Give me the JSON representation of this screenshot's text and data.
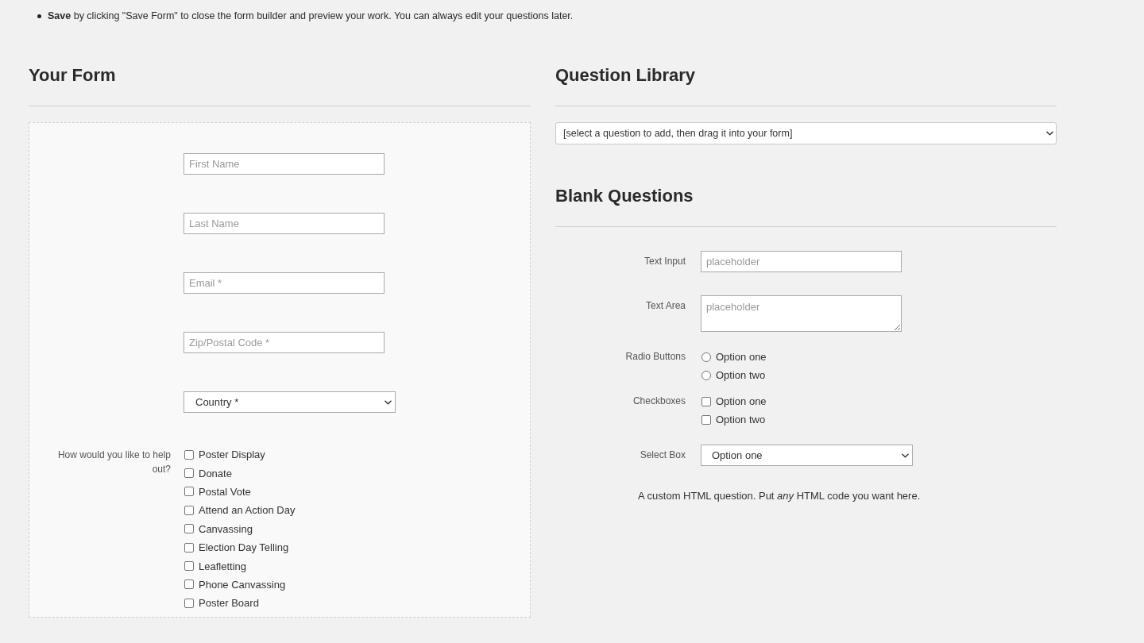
{
  "instructions": [
    {
      "text": "**Save** by clicking \"Save Form\" to close the form builder and preview your work. You can always edit your questions later."
    }
  ],
  "your_form": {
    "heading": "Your Form",
    "fields": [
      {
        "kind": "text",
        "placeholder": "First Name"
      },
      {
        "kind": "text",
        "placeholder": "Last Name"
      },
      {
        "kind": "text",
        "placeholder": "Email *"
      },
      {
        "kind": "text",
        "placeholder": "Zip/Postal Code *"
      },
      {
        "kind": "select",
        "value": "Country *"
      },
      {
        "kind": "checkbox_group",
        "label": "How would you like to help out?",
        "options": [
          {
            "label": "Poster Display",
            "checked": false
          },
          {
            "label": "Donate",
            "checked": false
          },
          {
            "label": "Postal Vote",
            "checked": false
          },
          {
            "label": "Attend an Action Day",
            "checked": false
          },
          {
            "label": "Canvassing",
            "checked": false
          },
          {
            "label": "Election Day Telling",
            "checked": false
          },
          {
            "label": "Leafletting",
            "checked": false
          },
          {
            "label": "Phone Canvassing",
            "checked": false
          },
          {
            "label": "Poster Board",
            "checked": false
          }
        ]
      }
    ]
  },
  "question_library": {
    "heading": "Question Library",
    "select": {
      "value": "[select a question to add, then drag it into your form]"
    }
  },
  "blank_questions": {
    "heading": "Blank Questions",
    "questions": [
      {
        "kind": "text",
        "label": "Text Input",
        "placeholder": "placeholder"
      },
      {
        "kind": "textarea",
        "label": "Text Area",
        "placeholder": "placeholder"
      },
      {
        "kind": "radio",
        "label": "Radio Buttons",
        "options": [
          {
            "label": "Option one",
            "selected": false
          },
          {
            "label": "Option two",
            "selected": false
          }
        ]
      },
      {
        "kind": "checkbox",
        "label": "Checkboxes",
        "options": [
          {
            "label": "Option one",
            "checked": false
          },
          {
            "label": "Option two",
            "checked": false
          }
        ]
      },
      {
        "kind": "select",
        "label": "Select Box",
        "value": "Option one"
      },
      {
        "kind": "html",
        "text": "A custom HTML question. Put *any* HTML code you want here."
      }
    ]
  }
}
